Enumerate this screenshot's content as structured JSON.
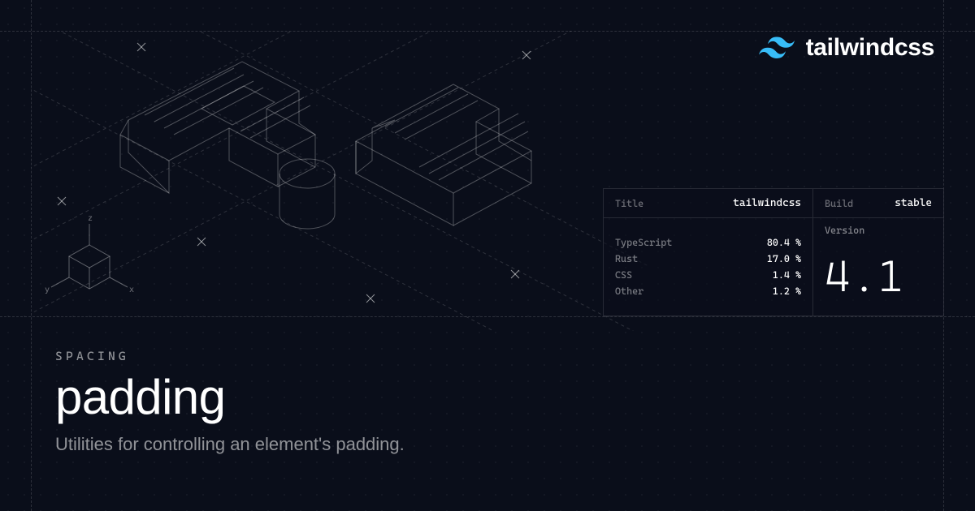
{
  "brand": {
    "name": "tailwindcss"
  },
  "panel": {
    "title_label": "Title",
    "title_value": "tailwindcss",
    "build_label": "Build",
    "build_value": "stable",
    "version_label": "Version",
    "version_value": "4.1",
    "stats": [
      {
        "k": "TypeScript",
        "v": "80.4 %"
      },
      {
        "k": "Rust",
        "v": "17.0 %"
      },
      {
        "k": "CSS",
        "v": "1.4 %"
      },
      {
        "k": "Other",
        "v": "1.2 %"
      }
    ]
  },
  "axis": {
    "x": "x",
    "y": "y",
    "z": "z"
  },
  "page": {
    "eyebrow": "SPACING",
    "title": "padding",
    "subtitle": "Utilities for controlling an element's padding."
  }
}
